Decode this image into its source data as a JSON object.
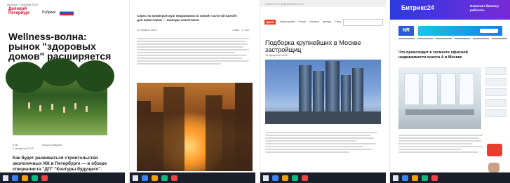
{
  "panels": {
    "p1": {
      "topbar": "пятница 7 октября 2022",
      "logo": "Деловой Петербург",
      "nav": [
        "Рубрики"
      ],
      "headline": "Wellness-волна: рынок \"здоровых домов\" расширяется",
      "meta_left": "9:30",
      "meta_left_sub": "7 февраля 2022",
      "meta_right": "Ольга Зайцева",
      "subheadline": "Как будет развиваться строительство экологичных ЖК в Петербурге — в обзоре специалиста \"ДП\" \"Контуры будущего\".",
      "photo_icon": "outdoor-yoga-photo"
    },
    "p2": {
      "title": "Спрос на коммерческую недвижимость новой «золотой жилой» для инвесторов — выводы аналитиков",
      "meta_left": "19 января 2022",
      "meta_right": "1 мин · 4 тыс",
      "photo_icon": "sunset-city-photo"
    },
    "p3": {
      "header_hint": "НОВОСТИ НЕДВИЖИМОСТИ",
      "logo": "ЦИАН",
      "nav": [
        "Новостройки",
        "Рынок",
        "Ипотека",
        "Аренда",
        "Спец"
      ],
      "headline": "Подборка крупнейших в Москве застройщиц",
      "date": "18 февраля 2022",
      "photo_icon": "moscow-towers-photo"
    },
    "p4": {
      "banner_brand": "Битрикс24",
      "banner_text": "Помогает бизнесу работать",
      "logo": "NR",
      "headline": "Что происходит в сегменте офисной недвижимости класса А в Москве",
      "photo_icon": "office-interior-photo"
    }
  },
  "colors": {
    "red": "#c8102e",
    "cian_orange": "#ee3b24",
    "bitrix_blue": "#2b3ae0",
    "taskbar": "#1b1f2a"
  }
}
